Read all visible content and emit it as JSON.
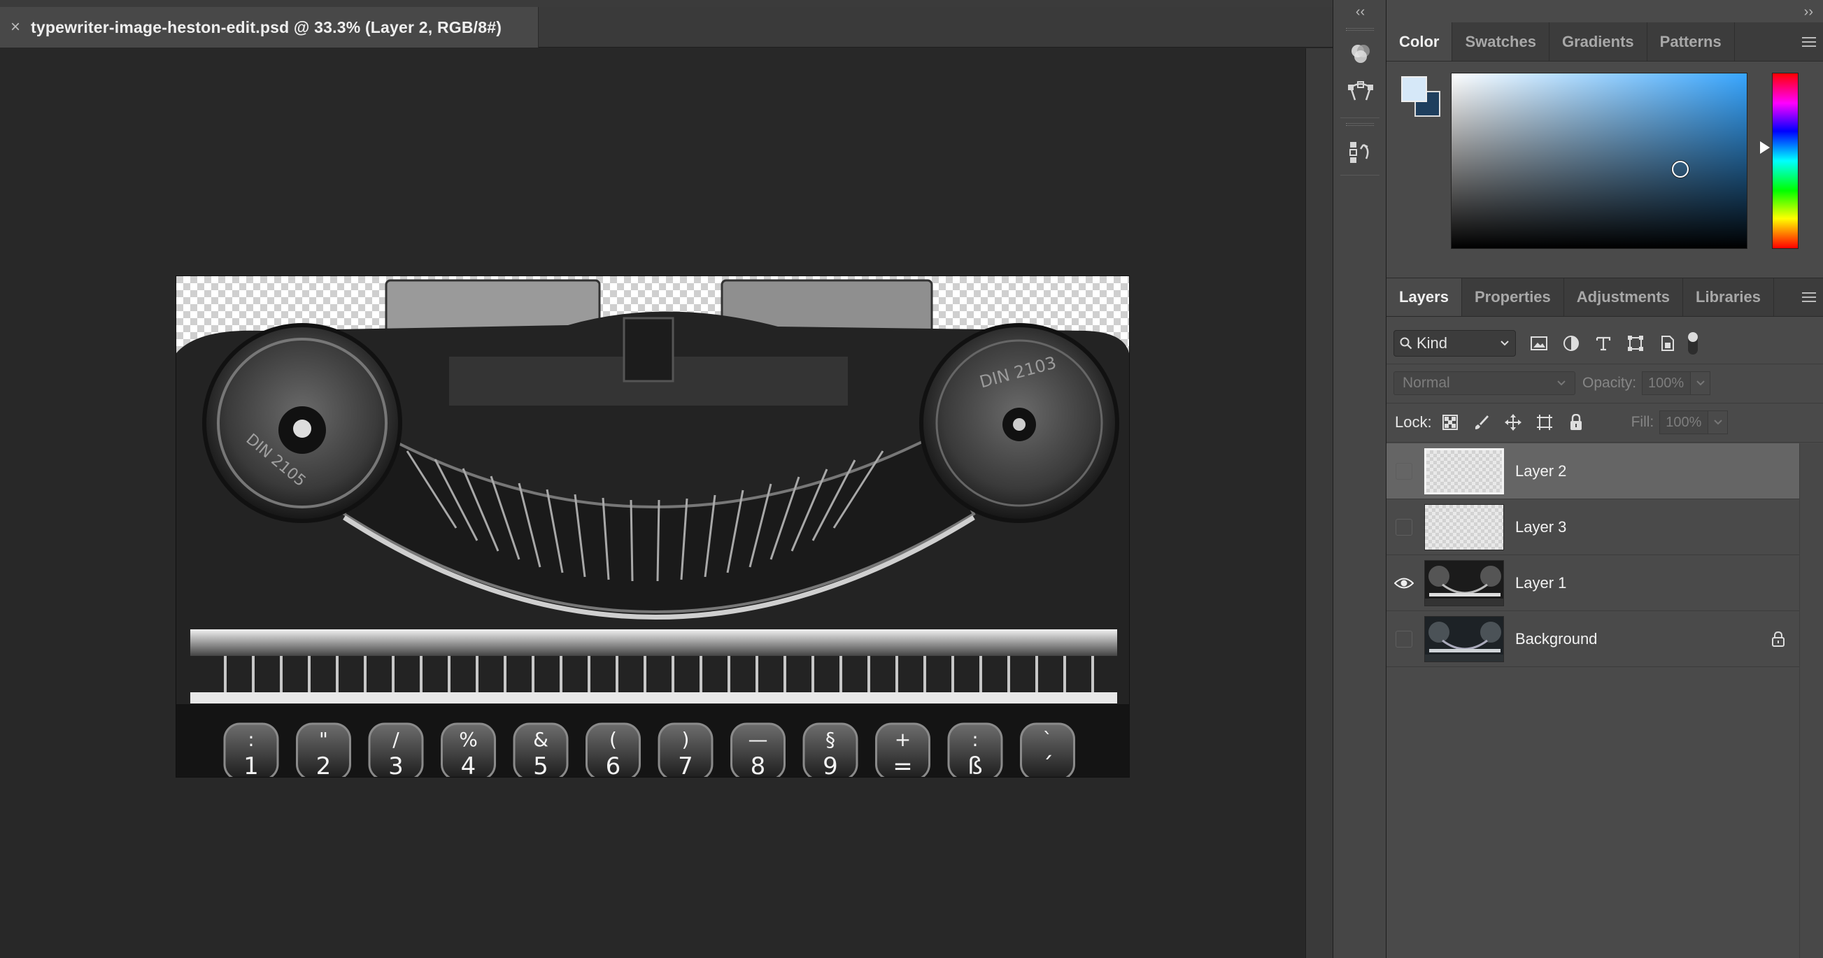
{
  "document": {
    "tab_title": "typewriter-image-heston-edit.psd @ 33.3% (Layer 2, RGB/8#)",
    "close_glyph": "×"
  },
  "canvas": {
    "key_labels": [
      {
        "top": ":",
        "bottom": "1"
      },
      {
        "top": "\"",
        "bottom": "2"
      },
      {
        "top": "/",
        "bottom": "3"
      },
      {
        "top": "%",
        "bottom": "4"
      },
      {
        "top": "&",
        "bottom": "5"
      },
      {
        "top": "(",
        "bottom": "6"
      },
      {
        "top": ")",
        "bottom": "7"
      },
      {
        "top": "—",
        "bottom": "8"
      },
      {
        "top": "§",
        "bottom": "9"
      },
      {
        "top": "+",
        "bottom": "="
      },
      {
        "top": ":",
        "bottom": "ß"
      },
      {
        "top": "`",
        "bottom": "´"
      }
    ],
    "spool_left_label": "DIN 2105",
    "spool_right_label": "DIN 2103"
  },
  "icon_column": {
    "collapse_glyph": "‹‹",
    "tools": [
      "color-channels-icon",
      "paths-icon",
      "history-icon"
    ]
  },
  "color_panel": {
    "collapse_glyph": "››",
    "tabs": [
      "Color",
      "Swatches",
      "Gradients",
      "Patterns"
    ],
    "active_tab": "Color",
    "foreground_color": "#d6e8f8",
    "background_color": "#1f3f5e",
    "hue_color": "#38a6ff"
  },
  "layers_panel": {
    "tabs": [
      "Layers",
      "Properties",
      "Adjustments",
      "Libraries"
    ],
    "active_tab": "Layers",
    "filter_kind": "Kind",
    "blend_mode": "Normal",
    "opacity_label": "Opacity:",
    "opacity_value": "100%",
    "lock_label": "Lock:",
    "fill_label": "Fill:",
    "fill_value": "100%",
    "layers": [
      {
        "name": "Layer 2",
        "visible": false,
        "selected": true,
        "locked": false
      },
      {
        "name": "Layer 3",
        "visible": false,
        "selected": false,
        "locked": false
      },
      {
        "name": "Layer 1",
        "visible": true,
        "selected": false,
        "locked": false
      },
      {
        "name": "Background",
        "visible": false,
        "selected": false,
        "locked": true
      }
    ]
  }
}
